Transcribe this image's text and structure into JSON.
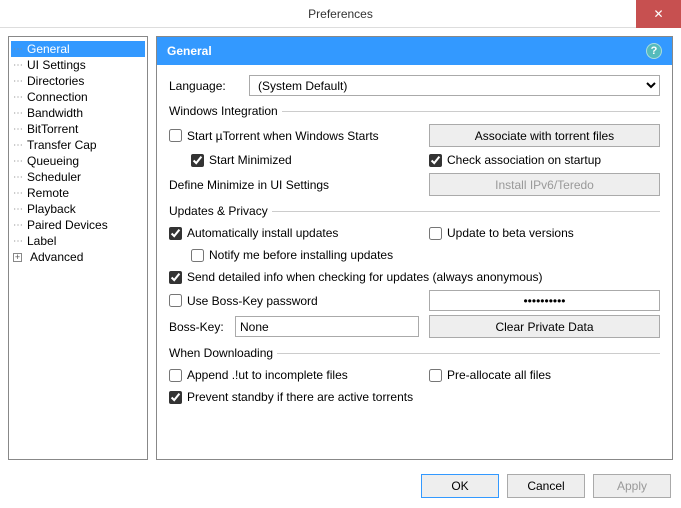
{
  "window": {
    "title": "Preferences"
  },
  "sidebar": {
    "items": [
      {
        "label": "General",
        "selected": true
      },
      {
        "label": "UI Settings"
      },
      {
        "label": "Directories"
      },
      {
        "label": "Connection"
      },
      {
        "label": "Bandwidth"
      },
      {
        "label": "BitTorrent"
      },
      {
        "label": "Transfer Cap"
      },
      {
        "label": "Queueing"
      },
      {
        "label": "Scheduler"
      },
      {
        "label": "Remote"
      },
      {
        "label": "Playback"
      },
      {
        "label": "Paired Devices"
      },
      {
        "label": "Label"
      },
      {
        "label": "Advanced",
        "expandable": true
      }
    ]
  },
  "panel": {
    "title": "General",
    "language": {
      "label": "Language:",
      "value": "(System Default)"
    },
    "win_integration": {
      "legend": "Windows Integration",
      "start_with_windows": {
        "label": "Start µTorrent when Windows Starts",
        "checked": false
      },
      "start_minimized": {
        "label": "Start Minimized",
        "checked": true
      },
      "define_minimize": "Define Minimize in UI Settings",
      "assoc_button": "Associate with torrent files",
      "check_assoc": {
        "label": "Check association on startup",
        "checked": true
      },
      "install_ipv6": "Install IPv6/Teredo"
    },
    "updates": {
      "legend": "Updates & Privacy",
      "auto_install": {
        "label": "Automatically install updates",
        "checked": true
      },
      "beta": {
        "label": "Update to beta versions",
        "checked": false
      },
      "notify_before": {
        "label": "Notify me before installing updates",
        "checked": false
      },
      "send_info": {
        "label": "Send detailed info when checking for updates (always anonymous)",
        "checked": true
      },
      "boss_key_pw": {
        "label": "Use Boss-Key password",
        "checked": false
      },
      "password_value": "••••••••••",
      "boss_key_label": "Boss-Key:",
      "boss_key_value": "None",
      "clear_private": "Clear Private Data"
    },
    "downloading": {
      "legend": "When Downloading",
      "append_ut": {
        "label": "Append .!ut to incomplete files",
        "checked": false
      },
      "preallocate": {
        "label": "Pre-allocate all files",
        "checked": false
      },
      "prevent_standby": {
        "label": "Prevent standby if there are active torrents",
        "checked": true
      }
    }
  },
  "buttons": {
    "ok": "OK",
    "cancel": "Cancel",
    "apply": "Apply"
  }
}
